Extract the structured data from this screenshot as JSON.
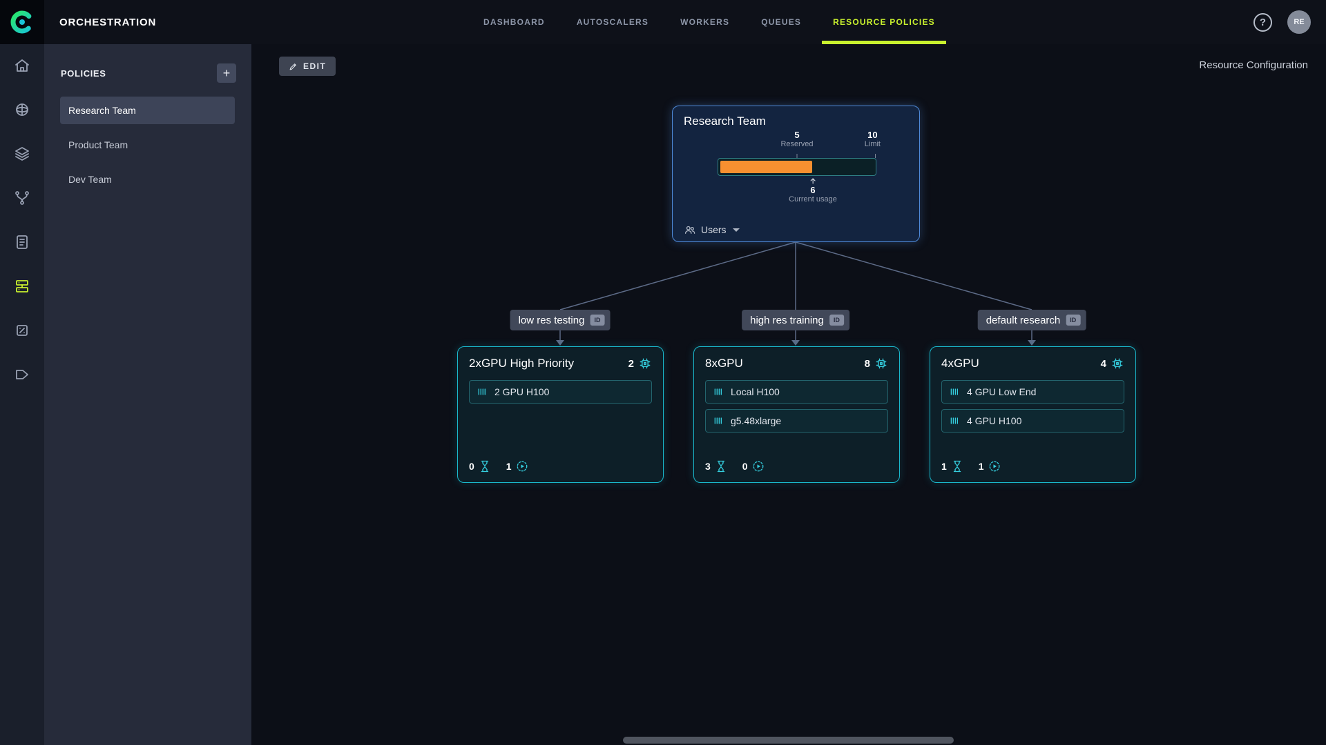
{
  "topbar": {
    "app_title": "ORCHESTRATION",
    "nav": [
      {
        "label": "DASHBOARD"
      },
      {
        "label": "AUTOSCALERS"
      },
      {
        "label": "WORKERS"
      },
      {
        "label": "QUEUES"
      },
      {
        "label": "RESOURCE POLICIES"
      }
    ],
    "help_glyph": "?",
    "avatar_initials": "RE"
  },
  "rail": {
    "icons": [
      "home",
      "projects",
      "datasets",
      "pipelines",
      "reports",
      "orchestration",
      "models",
      "applications"
    ],
    "active": "orchestration"
  },
  "sidebar": {
    "title": "POLICIES",
    "add_label": "+",
    "items": [
      {
        "label": "Research Team",
        "selected": true
      },
      {
        "label": "Product Team",
        "selected": false
      },
      {
        "label": "Dev Team",
        "selected": false
      }
    ]
  },
  "toolbar": {
    "edit_label": "EDIT",
    "right_label": "Resource Configuration"
  },
  "root": {
    "title": "Research Team",
    "reserved_value": "5",
    "reserved_label": "Reserved",
    "limit_value": "10",
    "limit_label": "Limit",
    "usage_value": "6",
    "usage_label": "Current usage",
    "users_label": "Users",
    "reserved_pct": 50,
    "usage_pct": 60
  },
  "labels": {
    "id_badge": "ID"
  },
  "pills": [
    {
      "label": "low res testing"
    },
    {
      "label": "high res training"
    },
    {
      "label": "default research"
    }
  ],
  "cards": [
    {
      "title": "2xGPU High Priority",
      "gpu_count": "2",
      "rows": [
        {
          "label": "2 GPU H100"
        }
      ],
      "pending": "0",
      "running": "1"
    },
    {
      "title": "8xGPU",
      "gpu_count": "8",
      "rows": [
        {
          "label": "Local H100"
        },
        {
          "label": "g5.48xlarge"
        }
      ],
      "pending": "3",
      "running": "0"
    },
    {
      "title": "4xGPU",
      "gpu_count": "4",
      "rows": [
        {
          "label": "4 GPU Low End"
        },
        {
          "label": "4 GPU H100"
        }
      ],
      "pending": "1",
      "running": "1"
    }
  ],
  "colors": {
    "accent": "#c9f12e",
    "root_card_border": "#4f8ad9",
    "node_card_border": "#1ab8cc",
    "usage_bar_fill": "#f79030",
    "icon_cyan": "#35d0e0"
  }
}
